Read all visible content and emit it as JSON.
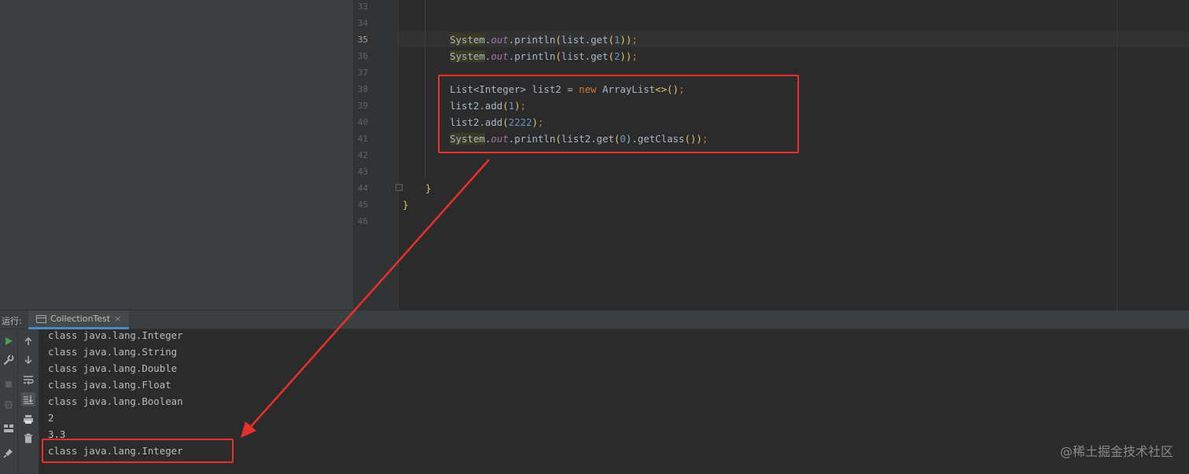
{
  "editor": {
    "line_numbers": [
      "33",
      "34",
      "35",
      "36",
      "37",
      "38",
      "39",
      "40",
      "41",
      "42",
      "43",
      "44",
      "45",
      "46"
    ],
    "active_line": "35",
    "code": {
      "l35": {
        "sys": "System",
        "dot1": ".",
        "out": "out",
        "rest": ".println",
        "p1": "(",
        "arg": "list.get",
        "p2": "(",
        "num": "1",
        "p3": "))",
        "semi": ";"
      },
      "l36": {
        "sys": "System",
        "dot1": ".",
        "out": "out",
        "rest": ".println",
        "p1": "(",
        "arg": "list.get",
        "p2": "(",
        "num": "2",
        "p3": "))",
        "semi": ";"
      },
      "l38": {
        "type": "List<Integer> list2 = ",
        "kw": "new",
        "cls": " ArrayList",
        "gen": "<>",
        "paren": "()",
        "semi": ";"
      },
      "l39": {
        "text": "list2.add",
        "p1": "(",
        "num": "1",
        "p2": ")",
        "semi": ";"
      },
      "l40": {
        "text": "list2.add",
        "p1": "(",
        "num": "2222",
        "p2": ")",
        "semi": ";"
      },
      "l41": {
        "sys": "System",
        "dot1": ".",
        "out": "out",
        "rest": ".println",
        "p1": "(",
        "arg": "list2.get",
        "p2": "(",
        "num": "0",
        "p3": ").getClass",
        "p4": "())",
        "semi": ";"
      },
      "l44": "}",
      "l45": "}"
    }
  },
  "run": {
    "label": "运行:",
    "tab_label": "CollectionTest",
    "tab_close": "×",
    "output": [
      "class java.lang.Integer",
      "class java.lang.String",
      "class java.lang.Double",
      "class java.lang.Float",
      "class java.lang.Boolean",
      "2",
      "3.3",
      "class java.lang.Integer"
    ]
  },
  "toolbar_icons": {
    "left": [
      "run-icon",
      "wrench-icon",
      "stop-icon",
      "debug-icon",
      "layout-icon",
      "pin-icon"
    ],
    "right": [
      "arrow-up-icon",
      "arrow-down-icon",
      "soft-wrap-icon",
      "scroll-to-end-icon",
      "print-icon",
      "trash-icon"
    ]
  },
  "watermark": "@稀土掘金技术社区",
  "colors": {
    "annotation_red": "#e8302a",
    "run_green": "#499c54",
    "tab_underline": "#4a88c7"
  }
}
